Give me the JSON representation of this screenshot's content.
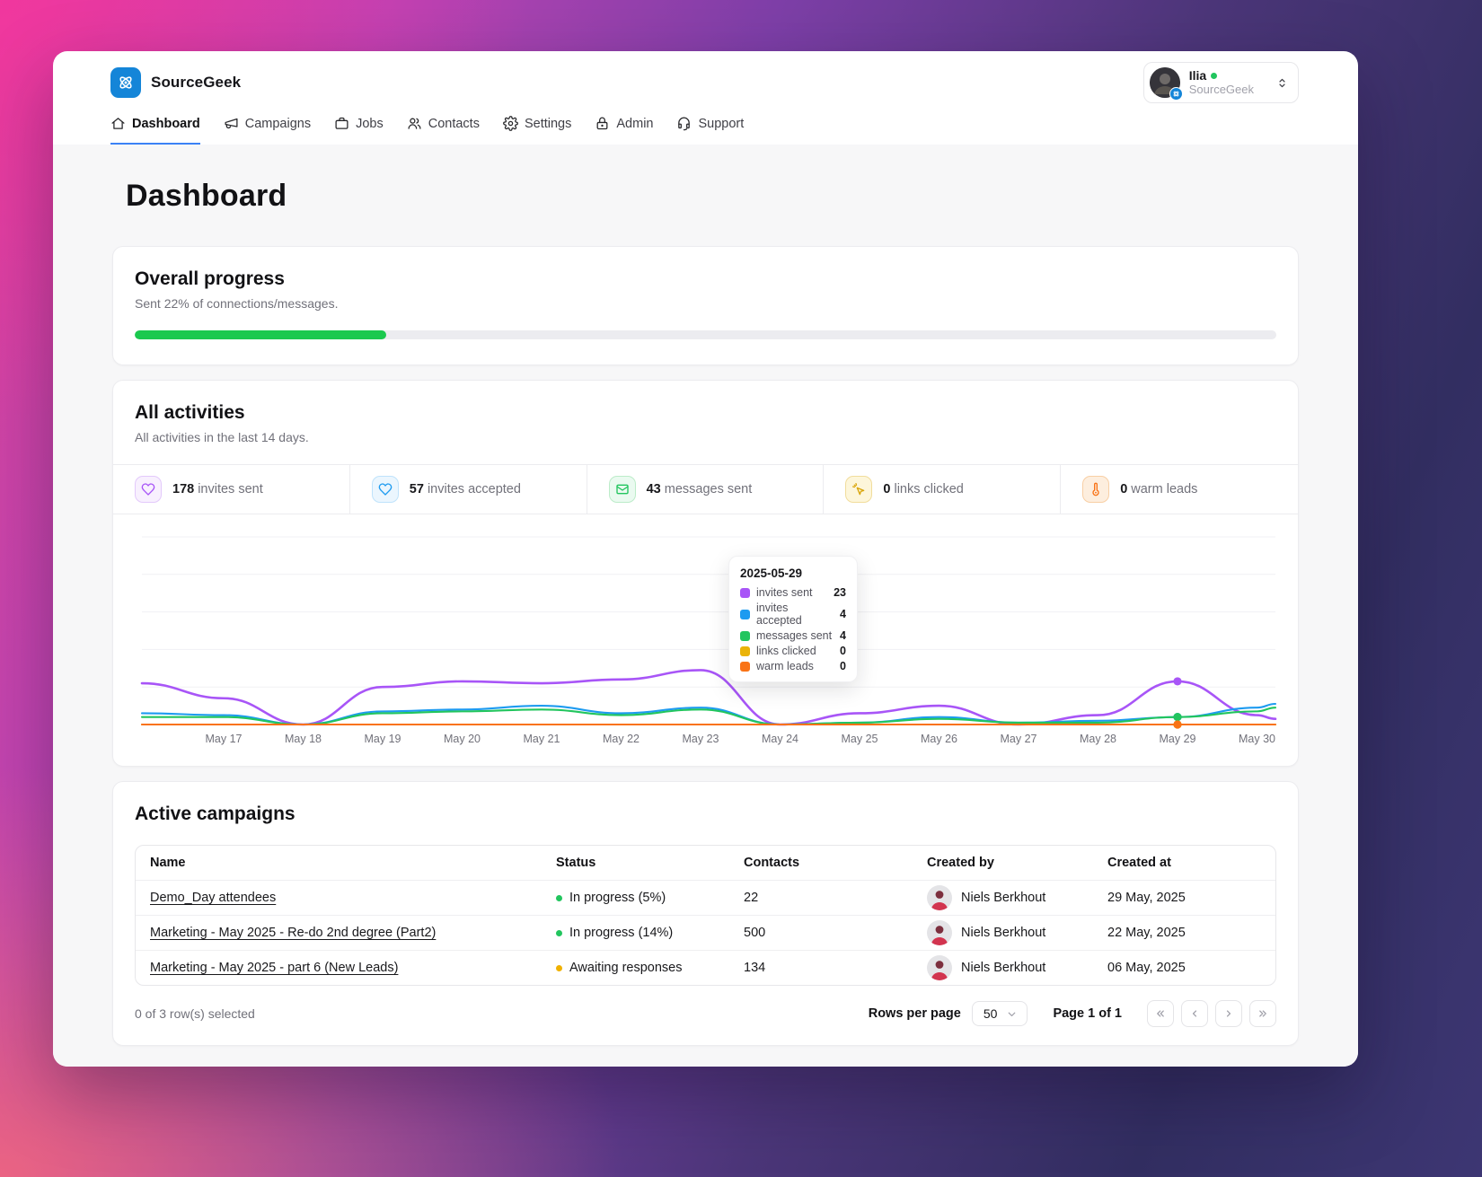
{
  "brand": {
    "name": "SourceGeek"
  },
  "user_menu": {
    "name": "Ilia",
    "org": "SourceGeek",
    "online_color": "#22c55e"
  },
  "nav": {
    "items": [
      {
        "label": "Dashboard",
        "active": true
      },
      {
        "label": "Campaigns",
        "active": false
      },
      {
        "label": "Jobs",
        "active": false
      },
      {
        "label": "Contacts",
        "active": false
      },
      {
        "label": "Settings",
        "active": false
      },
      {
        "label": "Admin",
        "active": false
      },
      {
        "label": "Support",
        "active": false
      }
    ]
  },
  "page": {
    "title": "Dashboard"
  },
  "overall_progress": {
    "title": "Overall progress",
    "subtitle": "Sent 22% of connections/messages.",
    "percent": "22%",
    "bar_color": "#1bc94e"
  },
  "activities": {
    "title": "All activities",
    "subtitle": "All activities in the last 14 days.",
    "stats": [
      {
        "value": "178",
        "label": "invites sent",
        "color": "#a855f7"
      },
      {
        "value": "57",
        "label": "invites accepted",
        "color": "#1d9bf0"
      },
      {
        "value": "43",
        "label": "messages sent",
        "color": "#22c55e"
      },
      {
        "value": "0",
        "label": "links clicked",
        "color": "#eab308"
      },
      {
        "value": "0",
        "label": "warm leads",
        "color": "#f97316"
      }
    ]
  },
  "chart_data": {
    "type": "line",
    "title": "All activities in the last 14 days",
    "categories": [
      "May 17",
      "May 18",
      "May 19",
      "May 20",
      "May 21",
      "May 22",
      "May 23",
      "May 24",
      "May 25",
      "May 26",
      "May 27",
      "May 28",
      "May 29",
      "May 30"
    ],
    "ylim": [
      0,
      100
    ],
    "grid_values": [
      20,
      40,
      60,
      80,
      100
    ],
    "grid": true,
    "legend_position": "tooltip-only",
    "series": [
      {
        "name": "invites sent",
        "color": "#a855f7",
        "left_edge": 22,
        "right_edge": 3,
        "values": [
          14,
          0,
          20,
          23,
          22,
          24,
          29,
          0,
          6,
          10,
          0,
          5,
          23,
          5
        ]
      },
      {
        "name": "invites accepted",
        "color": "#1d9bf0",
        "left_edge": 6,
        "right_edge": 11,
        "values": [
          5,
          0,
          7,
          8,
          10,
          6,
          9,
          0,
          1,
          4,
          1,
          2,
          4,
          9
        ]
      },
      {
        "name": "messages sent",
        "color": "#22c55e",
        "left_edge": 4,
        "right_edge": 9,
        "values": [
          4,
          0,
          6,
          7,
          8,
          5,
          8,
          0,
          1,
          3,
          1,
          1,
          4,
          7
        ]
      },
      {
        "name": "links clicked",
        "color": "#eab308",
        "left_edge": 0,
        "right_edge": 0,
        "values": [
          0,
          0,
          0,
          0,
          0,
          0,
          0,
          0,
          0,
          0,
          0,
          0,
          0,
          0
        ]
      },
      {
        "name": "warm leads",
        "color": "#f97316",
        "left_edge": 0,
        "right_edge": 0,
        "values": [
          0,
          0,
          0,
          0,
          0,
          0,
          0,
          0,
          0,
          0,
          0,
          0,
          0,
          0
        ]
      }
    ],
    "highlight": {
      "category": "May 29",
      "index": 12
    }
  },
  "tooltip": {
    "date": "2025-05-29",
    "rows": [
      {
        "label": "invites sent",
        "value": "23"
      },
      {
        "label": "invites accepted",
        "value": "4"
      },
      {
        "label": "messages sent",
        "value": "4"
      },
      {
        "label": "links clicked",
        "value": "0"
      },
      {
        "label": "warm leads",
        "value": "0"
      }
    ]
  },
  "campaigns": {
    "title": "Active campaigns",
    "columns": [
      "Name",
      "Status",
      "Contacts",
      "Created by",
      "Created at"
    ],
    "rows": [
      {
        "name": "Demo_Day attendees",
        "status": "In progress (5%)",
        "status_color": "#22c55e",
        "contacts": "22",
        "created_by": "Niels Berkhout",
        "created_at": "29 May, 2025"
      },
      {
        "name": "Marketing - May 2025 - Re-do 2nd degree (Part2)",
        "status": "In progress (14%)",
        "status_color": "#22c55e",
        "contacts": "500",
        "created_by": "Niels Berkhout",
        "created_at": "22 May, 2025"
      },
      {
        "name": "Marketing - May 2025 - part 6 (New Leads)",
        "status": "Awaiting responses",
        "status_color": "#f0b100",
        "contacts": "134",
        "created_by": "Niels Berkhout",
        "created_at": "06 May, 2025"
      }
    ],
    "footer": {
      "selected_text": "0 of 3 row(s) selected",
      "rows_per_page_label": "Rows per page",
      "rows_per_page_value": "50",
      "page_text": "Page 1 of 1"
    }
  }
}
